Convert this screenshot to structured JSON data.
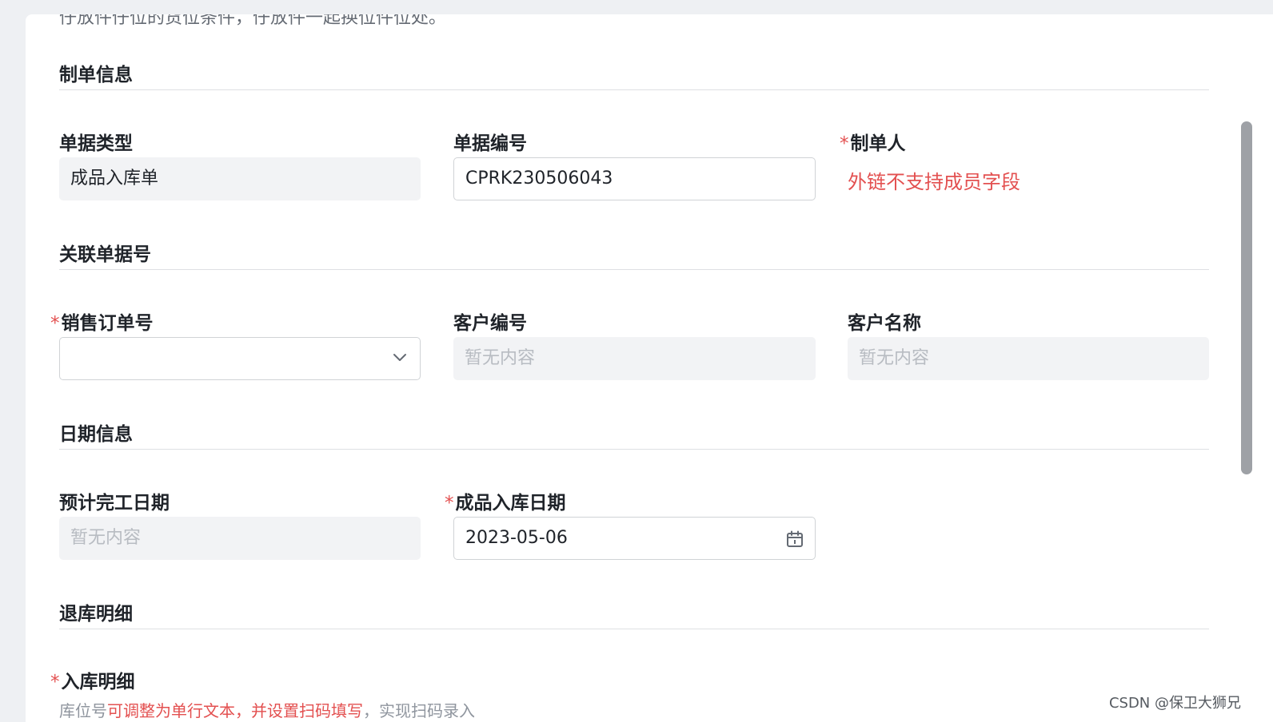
{
  "top_clipped_text": "仔放件仔位的货位条件，仔放件一起换位件位处。",
  "sections": {
    "document_info": "制单信息",
    "related_docs": "关联单据号",
    "date_info": "日期信息",
    "return_details": "退库明细"
  },
  "fields": {
    "doc_type": {
      "label": "单据类型",
      "value": "成品入库单"
    },
    "doc_number": {
      "label": "单据编号",
      "value": "CPRK230506043"
    },
    "creator": {
      "required_mark": "*",
      "label": "制单人",
      "message": "外链不支持成员字段"
    },
    "sales_order": {
      "required_mark": "*",
      "label": "销售订单号",
      "value": ""
    },
    "customer_code": {
      "label": "客户编号",
      "placeholder": "暂无内容"
    },
    "customer_name": {
      "label": "客户名称",
      "placeholder": "暂无内容"
    },
    "planned_finish_date": {
      "label": "预计完工日期",
      "placeholder": "暂无内容"
    },
    "warehousing_date": {
      "required_mark": "*",
      "label": "成品入库日期",
      "value": "2023-05-06"
    },
    "warehousing_details": {
      "required_mark": "*",
      "label": "入库明细"
    }
  },
  "hint": {
    "prefix": "库位号",
    "highlight": "可调整为单行文本，并设置扫码填写",
    "suffix": "，实现扫码录入"
  },
  "watermark": "CSDN @保卫大狮兄",
  "colors": {
    "required": "#e35050",
    "readonly_bg": "#f2f3f5",
    "border": "#d0d3d6"
  },
  "icons": {
    "select_arrow": "chevron-down-icon",
    "date_picker": "calendar-icon"
  }
}
